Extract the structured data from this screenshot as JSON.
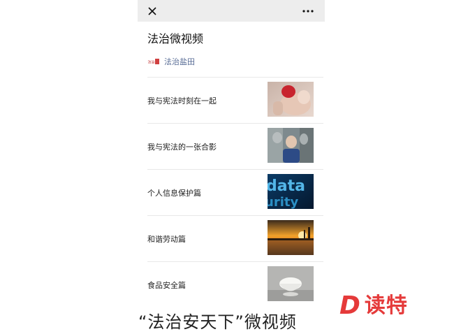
{
  "window": {
    "close_icon": "close-icon",
    "more_icon": "more-icon"
  },
  "article": {
    "title": "法治微视频",
    "account_logo_text": "法治盐田",
    "account_name": "法治盐田"
  },
  "videos": [
    {
      "title": "我与宪法时刻在一起",
      "thumb": "hands-image"
    },
    {
      "title": "我与宪法的一张合影",
      "thumb": "portrait-image"
    },
    {
      "title": "个人信息保护篇",
      "thumb": "data-security-image"
    },
    {
      "title": "和谐劳动篇",
      "thumb": "sunset-image"
    },
    {
      "title": "食品安全篇",
      "thumb": "rice-bowl-image"
    }
  ],
  "caption": "“法治安天下”微视频",
  "brand": {
    "letter": "D",
    "text": "读特",
    "color": "#e53a3a"
  }
}
